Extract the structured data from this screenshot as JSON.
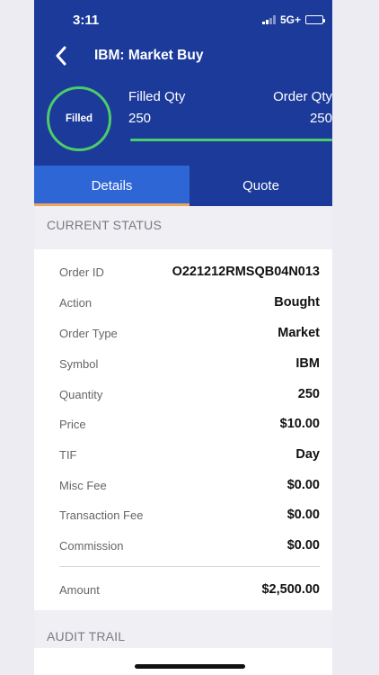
{
  "status_bar": {
    "time": "3:11",
    "network": "5G+"
  },
  "nav": {
    "title": "IBM: Market Buy"
  },
  "summary": {
    "status_badge": "Filled",
    "filled_qty_label": "Filled Qty",
    "filled_qty_value": "250",
    "order_qty_label": "Order Qty",
    "order_qty_value": "250",
    "fill_progress_fraction": 1.0
  },
  "tabs": [
    {
      "label": "Details",
      "active": true
    },
    {
      "label": "Quote",
      "active": false
    }
  ],
  "sections": {
    "current_status": "CURRENT STATUS",
    "audit_trail": "AUDIT TRAIL"
  },
  "details": [
    {
      "key": "Order ID",
      "value": "O221212RMSQB04N013"
    },
    {
      "key": "Action",
      "value": "Bought"
    },
    {
      "key": "Order Type",
      "value": "Market"
    },
    {
      "key": "Symbol",
      "value": "IBM"
    },
    {
      "key": "Quantity",
      "value": "250"
    },
    {
      "key": "Price",
      "value": "$10.00"
    },
    {
      "key": "TIF",
      "value": "Day"
    },
    {
      "key": "Misc Fee",
      "value": "$0.00"
    },
    {
      "key": "Transaction Fee",
      "value": "$0.00"
    },
    {
      "key": "Commission",
      "value": "$0.00"
    }
  ],
  "total": {
    "key": "Amount",
    "value": "$2,500.00"
  },
  "colors": {
    "header_blue": "#1b3a9a",
    "tab_active": "#2f66d6",
    "tab_underline": "#f0a35a",
    "status_green": "#4ccc69"
  }
}
